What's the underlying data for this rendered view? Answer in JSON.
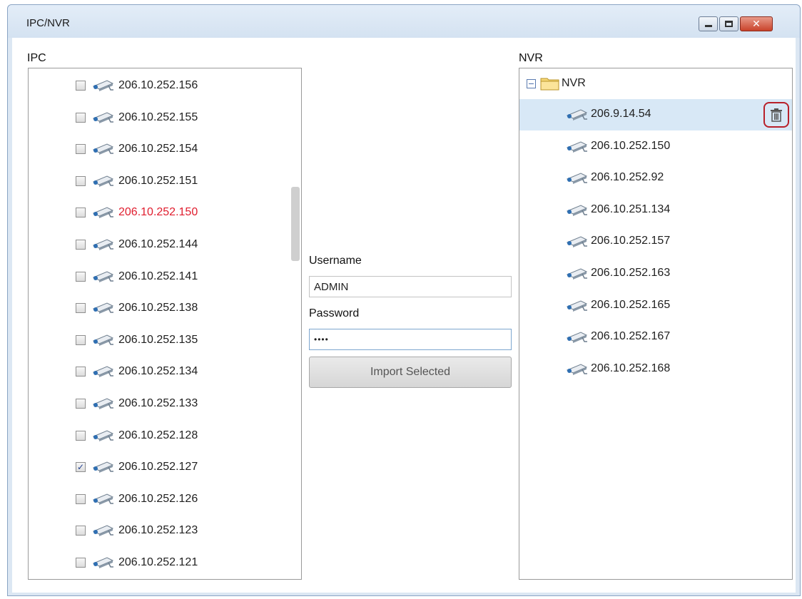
{
  "window": {
    "title": "IPC/NVR",
    "minimize_icon": "minimize-icon",
    "maximize_icon": "maximize-icon",
    "close_icon": "close-icon"
  },
  "ipc": {
    "label": "IPC",
    "items": [
      {
        "ip": "206.10.252.156",
        "checked": false,
        "highlight": false
      },
      {
        "ip": "206.10.252.155",
        "checked": false,
        "highlight": false
      },
      {
        "ip": "206.10.252.154",
        "checked": false,
        "highlight": false
      },
      {
        "ip": "206.10.252.151",
        "checked": false,
        "highlight": false
      },
      {
        "ip": "206.10.252.150",
        "checked": false,
        "highlight": true
      },
      {
        "ip": "206.10.252.144",
        "checked": false,
        "highlight": false
      },
      {
        "ip": "206.10.252.141",
        "checked": false,
        "highlight": false
      },
      {
        "ip": "206.10.252.138",
        "checked": false,
        "highlight": false
      },
      {
        "ip": "206.10.252.135",
        "checked": false,
        "highlight": false
      },
      {
        "ip": "206.10.252.134",
        "checked": false,
        "highlight": false
      },
      {
        "ip": "206.10.252.133",
        "checked": false,
        "highlight": false
      },
      {
        "ip": "206.10.252.128",
        "checked": false,
        "highlight": false
      },
      {
        "ip": "206.10.252.127",
        "checked": true,
        "highlight": false
      },
      {
        "ip": "206.10.252.126",
        "checked": false,
        "highlight": false
      },
      {
        "ip": "206.10.252.123",
        "checked": false,
        "highlight": false
      },
      {
        "ip": "206.10.252.121",
        "checked": false,
        "highlight": false
      }
    ]
  },
  "form": {
    "username_label": "Username",
    "username_value": "ADMIN",
    "password_label": "Password",
    "password_value": "••••",
    "import_label": "Import Selected"
  },
  "nvr": {
    "label": "NVR",
    "root_label": "NVR",
    "items": [
      {
        "ip": "206.9.14.54",
        "selected": true
      },
      {
        "ip": "206.10.252.150",
        "selected": false
      },
      {
        "ip": "206.10.252.92",
        "selected": false
      },
      {
        "ip": "206.10.251.134",
        "selected": false
      },
      {
        "ip": "206.10.252.157",
        "selected": false
      },
      {
        "ip": "206.10.252.163",
        "selected": false
      },
      {
        "ip": "206.10.252.165",
        "selected": false
      },
      {
        "ip": "206.10.252.167",
        "selected": false
      },
      {
        "ip": "206.10.252.168",
        "selected": false
      }
    ]
  },
  "icons": {
    "camera": "camera-icon",
    "folder": "folder-icon",
    "trash": "trash-icon"
  },
  "colors": {
    "highlight_text": "#e01d2e",
    "selection_bg": "#d8e8f6",
    "trash_outline": "#b8202a"
  }
}
